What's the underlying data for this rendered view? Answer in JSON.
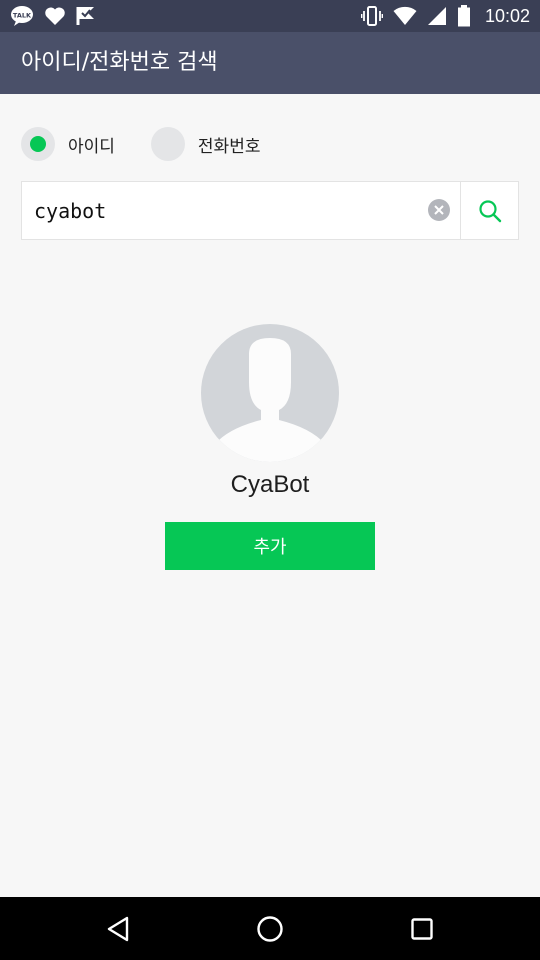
{
  "status_bar": {
    "left_icons": [
      "kakaotalk-icon",
      "heart-icon",
      "flag-check-icon"
    ],
    "right_icons": [
      "vibrate-icon",
      "wifi-icon",
      "signal-icon",
      "battery-icon"
    ],
    "time": "10:02"
  },
  "app_bar": {
    "title": "아이디/전화번호 검색"
  },
  "search_type": {
    "options": [
      {
        "label": "아이디",
        "selected": true
      },
      {
        "label": "전화번호",
        "selected": false
      }
    ]
  },
  "search": {
    "value": "cyabot",
    "placeholder": "",
    "clear_icon": "clear-circle-icon",
    "search_icon": "search-icon"
  },
  "result": {
    "avatar_icon": "default-avatar-icon",
    "name": "CyaBot",
    "add_label": "추가"
  },
  "nav_bar": {
    "icons": [
      "back-icon",
      "home-icon",
      "recents-icon"
    ]
  },
  "colors": {
    "accent": "#06c755",
    "app_bar": "#4a5069",
    "status_bar": "#3a3f55",
    "background": "#f7f7f7"
  }
}
